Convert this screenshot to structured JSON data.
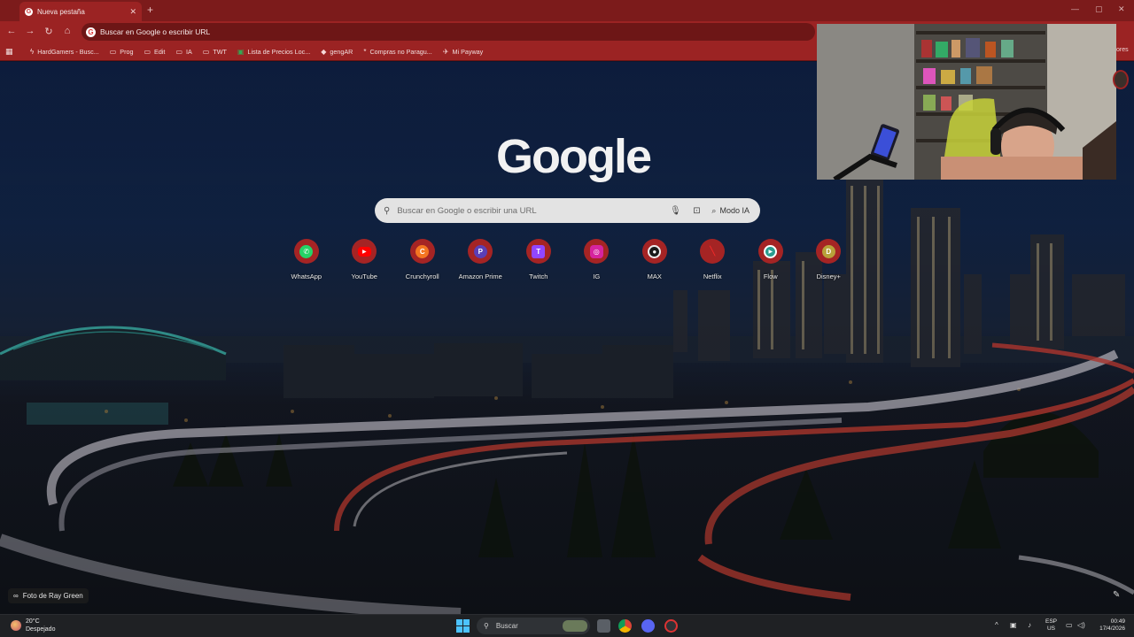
{
  "browser": {
    "tab_title": "Nueva pestaña",
    "tab_favicon": "G",
    "new_tab_glyph": "+",
    "close_glyph": "✕",
    "window_controls": [
      "—",
      "▢",
      "✕"
    ],
    "omnibox_text": "Buscar en Google o escribir URL",
    "bookmarks": [
      {
        "label": "HardGamers - Busc...",
        "icon": "bolt-icon"
      },
      {
        "label": "Prog",
        "icon": "folder-icon"
      },
      {
        "label": "Edit",
        "icon": "folder-icon"
      },
      {
        "label": "IA",
        "icon": "folder-icon"
      },
      {
        "label": "TWT",
        "icon": "folder-icon"
      },
      {
        "label": "Lista de Precios Loc...",
        "icon": "sheets-icon"
      },
      {
        "label": "gengAR",
        "icon": "ai-icon"
      },
      {
        "label": "Compras no Paragu...",
        "icon": "star-icon"
      },
      {
        "label": "Mi Payway",
        "icon": "payway-icon"
      }
    ],
    "bookmarks_overflow": "ores"
  },
  "ntp": {
    "logo": "Google",
    "search_placeholder": "Buscar en Google o escribir una URL",
    "ai_mode_label": "Modo IA",
    "shortcuts": [
      {
        "label": "WhatsApp",
        "icon": "whatsapp-icon",
        "color": "#25d366",
        "glyph": "✆"
      },
      {
        "label": "YouTube",
        "icon": "youtube-icon",
        "color": "#ff0000",
        "glyph": "▶"
      },
      {
        "label": "Crunchyroll",
        "icon": "crunchyroll-icon",
        "color": "#f47521",
        "glyph": "C"
      },
      {
        "label": "Amazon Prime",
        "icon": "prime-icon",
        "color": "#5b3fb5",
        "glyph": "P"
      },
      {
        "label": "Twitch",
        "icon": "twitch-icon",
        "color": "#9146ff",
        "glyph": "T"
      },
      {
        "label": "IG",
        "icon": "instagram-icon",
        "color": "#d6249f",
        "glyph": "◎"
      },
      {
        "label": "MAX",
        "icon": "max-icon",
        "color": "#1a1a1a",
        "glyph": "●"
      },
      {
        "label": "Netflix",
        "icon": "netflix-icon",
        "color": "#b20710",
        "glyph": "N"
      },
      {
        "label": "Flow",
        "icon": "flow-icon",
        "color": "#2a9d8f",
        "glyph": "▶"
      },
      {
        "label": "Disney+",
        "icon": "disney-icon",
        "color": "#b8a23a",
        "glyph": "D"
      }
    ],
    "photo_credit": "Foto de Ray Green"
  },
  "taskbar": {
    "weather_temp": "20°C",
    "weather_desc": "Despejado",
    "search_label": "Buscar",
    "lang_top": "ESP",
    "lang_bottom": "US",
    "time": "00:49",
    "date": "17/4/2026"
  },
  "colors": {
    "chrome": "#9b2323",
    "tabstrip": "#7c1b1b",
    "accent_blue": "#4cc2ff"
  }
}
